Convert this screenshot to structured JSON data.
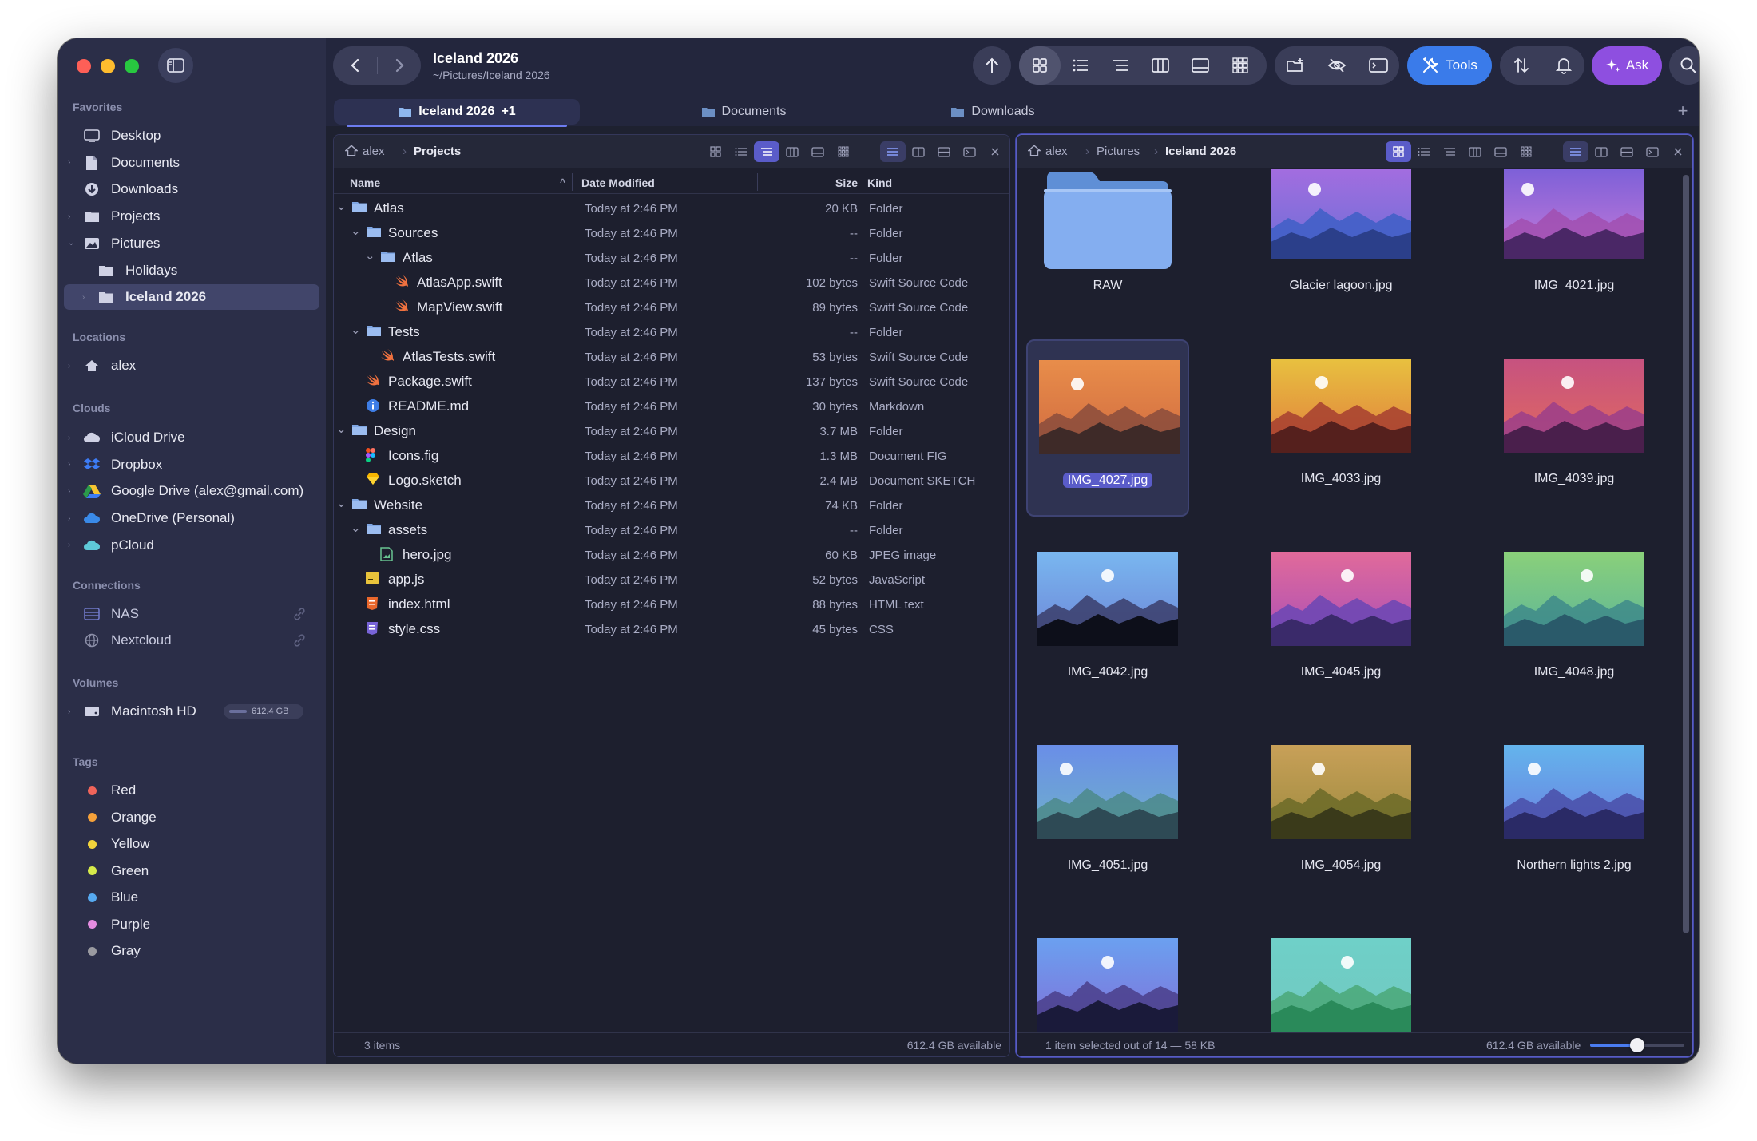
{
  "window": {
    "title": "Iceland 2026",
    "subtitle": "~/Pictures/Iceland 2026"
  },
  "toolbar": {
    "tools_label": "Tools",
    "ask_label": "Ask"
  },
  "tabs": [
    {
      "label": "Iceland 2026",
      "badge": "+1"
    },
    {
      "label": "Documents"
    },
    {
      "label": "Downloads"
    }
  ],
  "sidebar": {
    "favorites_title": "Favorites",
    "favorites": [
      "Desktop",
      "Documents",
      "Downloads",
      "Projects",
      "Pictures",
      "Holidays",
      "Iceland 2026"
    ],
    "locations_title": "Locations",
    "locations": [
      "alex"
    ],
    "clouds_title": "Clouds",
    "clouds": [
      "iCloud Drive",
      "Dropbox",
      "Google Drive (alex@gmail.com)",
      "OneDrive (Personal)",
      "pCloud"
    ],
    "connections_title": "Connections",
    "connections": [
      "NAS",
      "Nextcloud"
    ],
    "volumes_title": "Volumes",
    "volume_name": "Macintosh HD",
    "volume_size": "612.4 GB",
    "tags_title": "Tags",
    "tags": [
      {
        "name": "Red",
        "color": "#f0645a"
      },
      {
        "name": "Orange",
        "color": "#f5a13a"
      },
      {
        "name": "Yellow",
        "color": "#f2d43c"
      },
      {
        "name": "Green",
        "color": "#d6ea4a"
      },
      {
        "name": "Blue",
        "color": "#56a9f0"
      },
      {
        "name": "Purple",
        "color": "#e48ce0"
      },
      {
        "name": "Gray",
        "color": "#9a9aa0"
      }
    ]
  },
  "left_pane": {
    "path": [
      "alex",
      "Projects"
    ],
    "columns": {
      "name": "Name",
      "date": "Date Modified",
      "size": "Size",
      "kind": "Kind"
    },
    "rows": [
      {
        "name": "Atlas",
        "date": "Today at 2:46 PM",
        "size": "20 KB",
        "kind": "Folder",
        "icon": "folder-icon"
      },
      {
        "name": "Sources",
        "date": "Today at 2:46 PM",
        "size": "--",
        "kind": "Folder",
        "icon": "folder-icon"
      },
      {
        "name": "Atlas",
        "date": "Today at 2:46 PM",
        "size": "--",
        "kind": "Folder",
        "icon": "folder-icon"
      },
      {
        "name": "AtlasApp.swift",
        "date": "Today at 2:46 PM",
        "size": "102 bytes",
        "kind": "Swift Source Code",
        "icon": "swift-icon"
      },
      {
        "name": "MapView.swift",
        "date": "Today at 2:46 PM",
        "size": "89 bytes",
        "kind": "Swift Source Code",
        "icon": "swift-icon"
      },
      {
        "name": "Tests",
        "date": "Today at 2:46 PM",
        "size": "--",
        "kind": "Folder",
        "icon": "folder-icon"
      },
      {
        "name": "AtlasTests.swift",
        "date": "Today at 2:46 PM",
        "size": "53 bytes",
        "kind": "Swift Source Code",
        "icon": "swift-icon"
      },
      {
        "name": "Package.swift",
        "date": "Today at 2:46 PM",
        "size": "137 bytes",
        "kind": "Swift Source Code",
        "icon": "swift-icon"
      },
      {
        "name": "README.md",
        "date": "Today at 2:46 PM",
        "size": "30 bytes",
        "kind": "Markdown",
        "icon": "info-icon"
      },
      {
        "name": "Design",
        "date": "Today at 2:46 PM",
        "size": "3.7 MB",
        "kind": "Folder",
        "icon": "folder-icon"
      },
      {
        "name": "Icons.fig",
        "date": "Today at 2:46 PM",
        "size": "1.3 MB",
        "kind": "Document FIG",
        "icon": "figma-icon"
      },
      {
        "name": "Logo.sketch",
        "date": "Today at 2:46 PM",
        "size": "2.4 MB",
        "kind": "Document SKETCH",
        "icon": "sketch-icon"
      },
      {
        "name": "Website",
        "date": "Today at 2:46 PM",
        "size": "74 KB",
        "kind": "Folder",
        "icon": "folder-icon"
      },
      {
        "name": "assets",
        "date": "Today at 2:46 PM",
        "size": "--",
        "kind": "Folder",
        "icon": "folder-icon"
      },
      {
        "name": "hero.jpg",
        "date": "Today at 2:46 PM",
        "size": "60 KB",
        "kind": "JPEG image",
        "icon": "image-file-icon"
      },
      {
        "name": "app.js",
        "date": "Today at 2:46 PM",
        "size": "52 bytes",
        "kind": "JavaScript",
        "icon": "js-icon"
      },
      {
        "name": "index.html",
        "date": "Today at 2:46 PM",
        "size": "88 bytes",
        "kind": "HTML text",
        "icon": "html-icon"
      },
      {
        "name": "style.css",
        "date": "Today at 2:46 PM",
        "size": "45 bytes",
        "kind": "CSS",
        "icon": "css-icon"
      }
    ],
    "status_items": "3 items",
    "status_available": "612.4 GB available"
  },
  "right_pane": {
    "path": [
      "alex",
      "Pictures",
      "Iceland 2026"
    ],
    "items": [
      {
        "name": "RAW",
        "type": "folder"
      },
      {
        "name": "Glacier lagoon.jpg"
      },
      {
        "name": "IMG_4021.jpg"
      },
      {
        "name": "IMG_4027.jpg",
        "selected": true
      },
      {
        "name": "IMG_4033.jpg"
      },
      {
        "name": "IMG_4039.jpg"
      },
      {
        "name": "IMG_4042.jpg"
      },
      {
        "name": "IMG_4045.jpg"
      },
      {
        "name": "IMG_4048.jpg"
      },
      {
        "name": "IMG_4051.jpg"
      },
      {
        "name": "IMG_4054.jpg"
      },
      {
        "name": "Northern lights 2.jpg"
      },
      {
        "name": ""
      },
      {
        "name": ""
      }
    ],
    "status_selection": "1 item selected out of 14 — 58 KB",
    "status_available": "612.4 GB available",
    "zoom_level": 0.5
  }
}
